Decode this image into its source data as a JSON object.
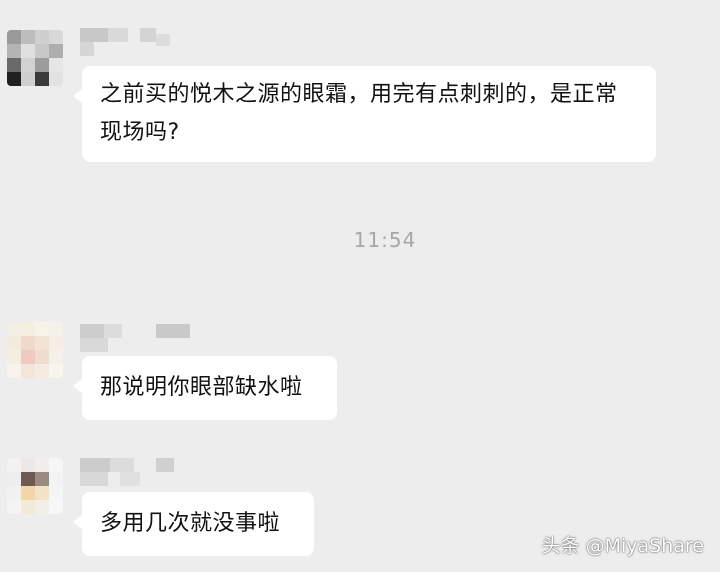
{
  "messages": [
    {
      "text": "之前买的悦木之源的眼霜，用完有点刺刺的，是正常现场吗?"
    },
    {
      "text": "那说明你眼部缺水啦"
    },
    {
      "text": "多用几次就没事啦"
    }
  ],
  "timestamp": "11:54",
  "watermark": "头条 @MiyaShare",
  "colors": {
    "background": "#ededed",
    "bubble": "#ffffff",
    "timestamp": "#a7a7a7"
  }
}
